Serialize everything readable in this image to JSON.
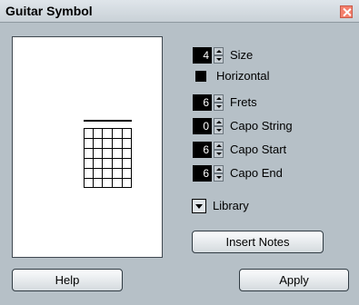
{
  "window": {
    "title": "Guitar Symbol",
    "close_icon": "close-icon"
  },
  "preview": {},
  "controls": {
    "size": {
      "value": "4",
      "label": "Size"
    },
    "horizontal": {
      "label": "Horizontal",
      "checked": false
    },
    "frets": {
      "value": "6",
      "label": "Frets"
    },
    "capo_string": {
      "value": "0",
      "label": "Capo String"
    },
    "capo_start": {
      "value": "6",
      "label": "Capo Start"
    },
    "capo_end": {
      "value": "6",
      "label": "Capo End"
    },
    "library": {
      "label": "Library"
    }
  },
  "buttons": {
    "insert_notes": "Insert Notes",
    "help": "Help",
    "apply": "Apply"
  },
  "colors": {
    "background": "#b6c0c7",
    "close_button": "#f47f6c",
    "value_box": "#000000"
  }
}
